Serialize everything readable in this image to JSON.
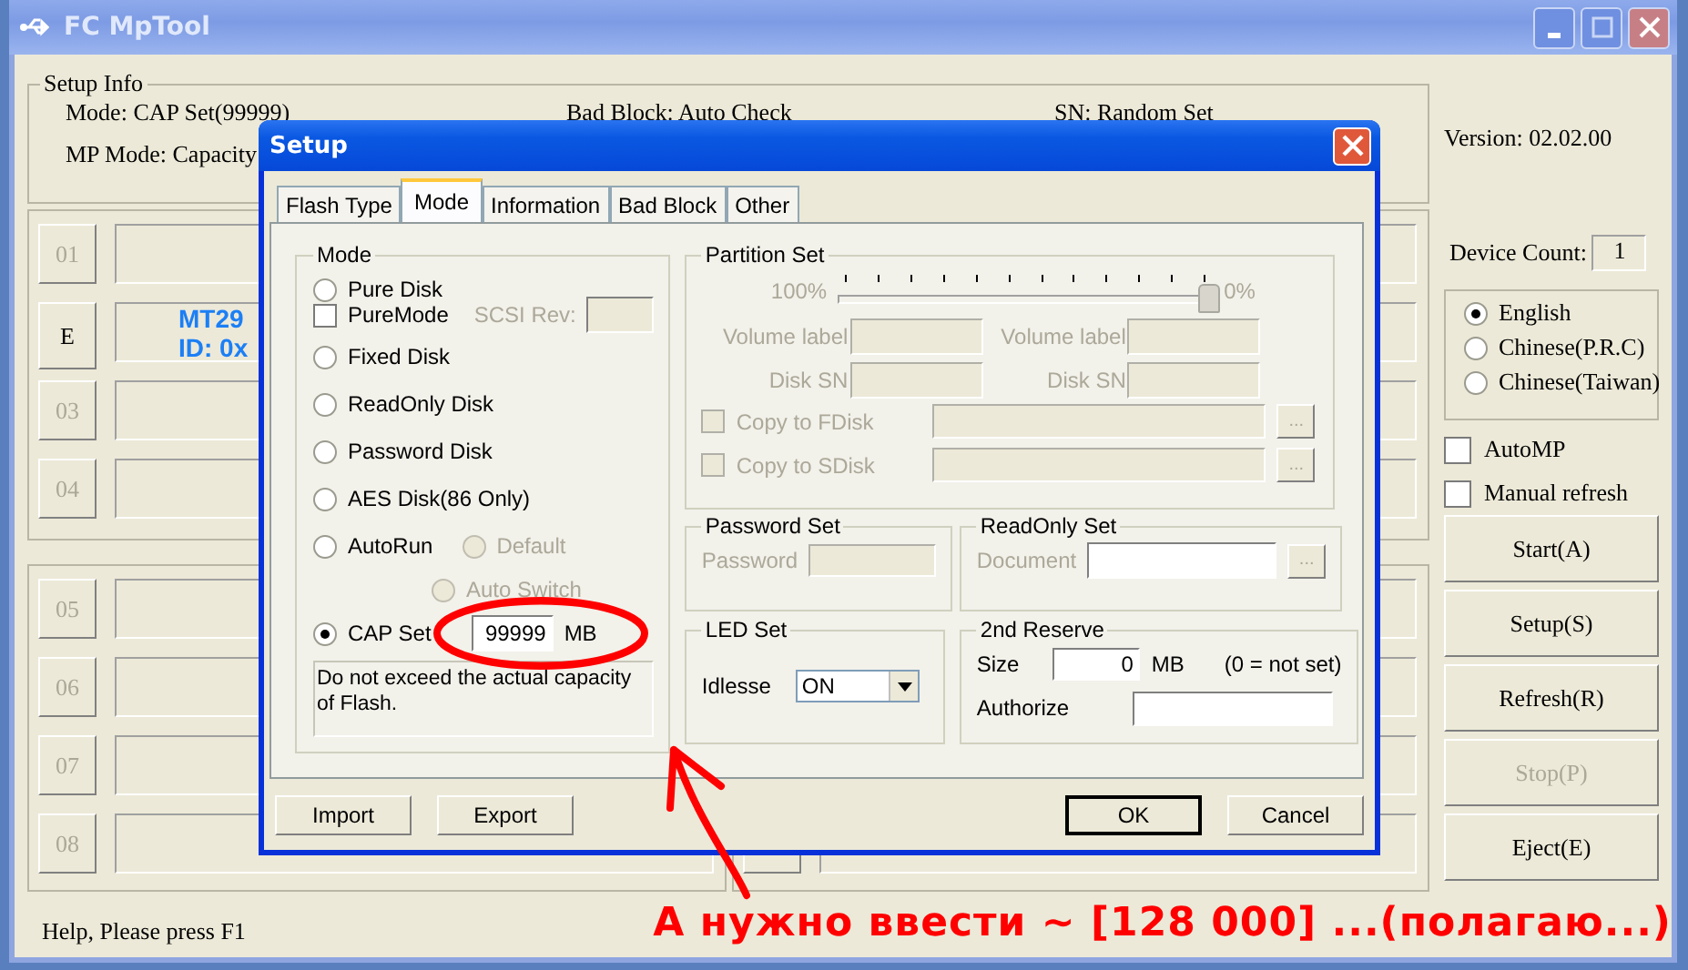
{
  "window": {
    "title": "FC MpTool"
  },
  "setup_info": {
    "title": "Setup Info",
    "row_1": [
      "Mode: CAP Set(99999)",
      "Bad Block: Auto Check",
      "SN: Random Set"
    ],
    "row_2": [
      "MP Mode: Capacity"
    ]
  },
  "device_panels": [
    {
      "slots": [
        {
          "label": "01",
          "active": false
        },
        {
          "label": "E",
          "active": true,
          "lines": [
            "MT29",
            "ID: 0x"
          ]
        },
        {
          "label": "03",
          "active": false
        },
        {
          "label": "04",
          "active": false
        }
      ]
    },
    {
      "slots": [
        {
          "label": "05",
          "active": false
        },
        {
          "label": "06",
          "active": false
        },
        {
          "label": "07",
          "active": false
        },
        {
          "label": "08",
          "active": false
        }
      ]
    }
  ],
  "version": "Version: 02.02.00",
  "device_count": {
    "label": "Device Count:",
    "value": "1"
  },
  "languages": [
    {
      "label": "English",
      "selected": true
    },
    {
      "label": "Chinese(P.R.C)",
      "selected": false
    },
    {
      "label": "Chinese(Taiwan)",
      "selected": false
    }
  ],
  "options": [
    {
      "label": "AutoMP",
      "checked": false
    },
    {
      "label": "Manual refresh",
      "checked": false
    }
  ],
  "actions": [
    {
      "label": "Start(A)",
      "disabled": false
    },
    {
      "label": "Setup(S)",
      "disabled": false
    },
    {
      "label": "Refresh(R)",
      "disabled": false
    },
    {
      "label": "Stop(P)",
      "disabled": true
    },
    {
      "label": "Eject(E)",
      "disabled": false
    }
  ],
  "status_bar": "Help, Please press F1",
  "dialog": {
    "title": "Setup",
    "tabs": [
      {
        "label": "Flash Type",
        "selected": false
      },
      {
        "label": "Mode",
        "selected": true
      },
      {
        "label": "Information",
        "selected": false
      },
      {
        "label": "Bad Block",
        "selected": false
      },
      {
        "label": "Other",
        "selected": false
      }
    ],
    "mode_group": {
      "title": "Mode",
      "options": [
        {
          "kind": "radio",
          "label": "Pure Disk",
          "selected": false
        },
        {
          "kind": "checkbox",
          "label": "PureMode",
          "checked": false,
          "field_label": "SCSI Rev:",
          "field_disabled": true
        },
        {
          "kind": "radio",
          "label": "Fixed Disk",
          "selected": false
        },
        {
          "kind": "radio",
          "label": "ReadOnly Disk",
          "selected": false
        },
        {
          "kind": "radio",
          "label": "Password Disk",
          "selected": false
        },
        {
          "kind": "radio",
          "label": "AES Disk(86 Only)",
          "selected": false
        },
        {
          "kind": "radio",
          "label": "AutoRun",
          "selected": false,
          "sub_options": [
            {
              "label": "Default",
              "selected": false,
              "disabled": true
            },
            {
              "label": "Auto Switch",
              "selected": false,
              "disabled": true
            }
          ]
        },
        {
          "kind": "radio",
          "label": "CAP Set",
          "selected": true,
          "value": "99999",
          "unit": "MB"
        }
      ],
      "note": "Do not exceed the actual capacity of Flash."
    },
    "partition_set": {
      "title": "Partition Set",
      "disabled": true,
      "slider": {
        "start_label": "100%",
        "end_label": "0%",
        "level": 1.0
      },
      "fields": [
        {
          "label": "Volume label"
        },
        {
          "label": "Volume label"
        },
        {
          "label": "Disk SN"
        },
        {
          "label": "Disk SN"
        }
      ],
      "copies": [
        {
          "label": "Copy to FDisk",
          "checked": false,
          "browse": "..."
        },
        {
          "label": "Copy to SDisk",
          "checked": false,
          "browse": "..."
        }
      ]
    },
    "password_set": {
      "title": "Password Set",
      "field_label": "Password",
      "disabled": true
    },
    "readonly_set": {
      "title": "ReadOnly Set",
      "field_label": "Document",
      "browse": "...",
      "disabled": true
    },
    "led_set": {
      "title": "LED Set",
      "field_label": "Idlesse",
      "value": "ON"
    },
    "reserve": {
      "title": "2nd Reserve",
      "size_label": "Size",
      "size_value": "0",
      "unit": "MB",
      "hint": "(0 = not set)",
      "authorize_label": "Authorize"
    },
    "buttons": [
      {
        "label": "Import",
        "default": false
      },
      {
        "label": "Export",
        "default": false
      },
      {
        "label": "OK",
        "default": true
      },
      {
        "label": "Cancel",
        "default": false
      }
    ]
  },
  "annotation": {
    "text": "А нужно ввести ~ [128 000] ...(полагаю...)"
  }
}
